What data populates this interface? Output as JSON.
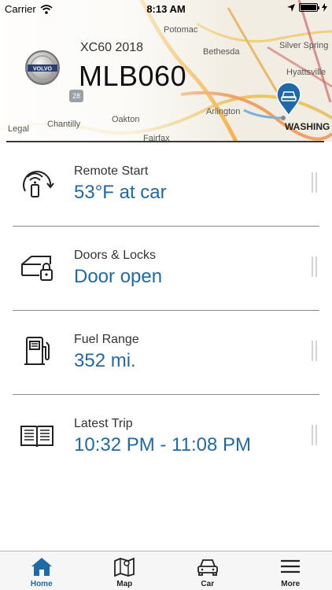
{
  "status_bar": {
    "carrier": "Carrier",
    "time": "8:13 AM"
  },
  "vehicle": {
    "model": "XC60 2018",
    "plate": "MLB060",
    "brand": "VOLVO"
  },
  "map": {
    "labels": {
      "potomac": "Potomac",
      "bethesda": "Bethesda",
      "silver_spring": "Silver Spring",
      "hyattsville": "Hyattsville",
      "arlington": "Arlington",
      "washington": "WASHING",
      "oakton": "Oakton",
      "chantilly": "Chantilly",
      "fairfax": "Fairfax",
      "legal": "Legal",
      "route": "28"
    }
  },
  "items": [
    {
      "label": "Remote Start",
      "value": "53°F at car"
    },
    {
      "label": "Doors & Locks",
      "value": "Door open"
    },
    {
      "label": "Fuel Range",
      "value": "352 mi."
    },
    {
      "label": "Latest Trip",
      "value": "10:32 PM - 11:08 PM"
    }
  ],
  "tabs": [
    {
      "label": "Home",
      "icon": "home-icon",
      "active": true
    },
    {
      "label": "Map",
      "icon": "map-icon"
    },
    {
      "label": "Car",
      "icon": "car-icon"
    },
    {
      "label": "More",
      "icon": "menu-icon"
    }
  ],
  "colors": {
    "accent": "#1f6aa6",
    "divider": "#8a8a8a"
  }
}
